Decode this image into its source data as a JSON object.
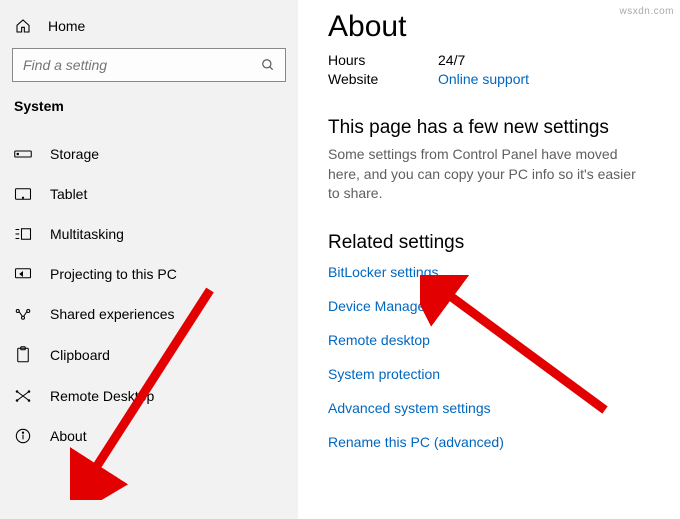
{
  "watermark": "wsxdn.com",
  "sidebar": {
    "home_label": "Home",
    "search_placeholder": "Find a setting",
    "section_label": "System",
    "items": [
      {
        "icon": "storage-icon",
        "label": "Storage"
      },
      {
        "icon": "tablet-icon",
        "label": "Tablet"
      },
      {
        "icon": "multitasking-icon",
        "label": "Multitasking"
      },
      {
        "icon": "projecting-icon",
        "label": "Projecting to this PC"
      },
      {
        "icon": "shared-experiences-icon",
        "label": "Shared experiences"
      },
      {
        "icon": "clipboard-icon",
        "label": "Clipboard"
      },
      {
        "icon": "remote-desktop-icon",
        "label": "Remote Desktop"
      },
      {
        "icon": "about-icon",
        "label": "About"
      }
    ]
  },
  "main": {
    "title": "About",
    "hours_label": "Hours",
    "hours_value": "24/7",
    "website_label": "Website",
    "website_value": "Online support",
    "new_settings_heading": "This page has a few new settings",
    "new_settings_text": "Some settings from Control Panel have moved here, and you can copy your PC info so it's easier to share.",
    "related_heading": "Related settings",
    "related_links": [
      "BitLocker settings",
      "Device Manager",
      "Remote desktop",
      "System protection",
      "Advanced system settings",
      "Rename this PC (advanced)"
    ]
  }
}
